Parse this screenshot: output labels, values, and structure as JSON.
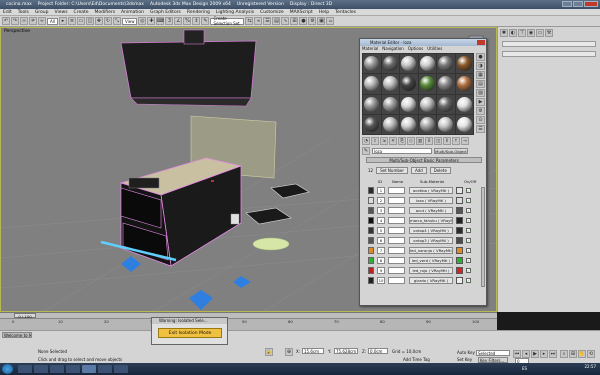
{
  "titlebar": {
    "app_file": "cocina.max",
    "project": "Project Folder: C:\\Users\\Ed\\Documents\\3dsmax",
    "app": "Autodesk 3ds Max Design 2009 x64",
    "status": "Unregistered Version",
    "display": "Display : Direct 3D"
  },
  "menubar": [
    "Edit",
    "Tools",
    "Group",
    "Views",
    "Create",
    "Modifiers",
    "Animation",
    "Graph Editors",
    "Rendering",
    "Lighting Analysis",
    "Customize",
    "MAXScript",
    "Help",
    "Tentacles"
  ],
  "toolbar": {
    "selection_filter": "All",
    "ref_coord": "View",
    "named_selection": "Create Selection Set"
  },
  "viewport": {
    "label": "Perspective"
  },
  "material_editor": {
    "title": "Material Editor - loza",
    "menu": [
      "Material",
      "Navigation",
      "Options",
      "Utilities"
    ],
    "material_name": "loza",
    "material_type": "Multi/Sub-Object",
    "rollout_title": "Multi/Sub-Object Basic Parameters",
    "count": "12",
    "set_number_label": "Set Number",
    "add_label": "Add",
    "delete_label": "Delete",
    "col_id": "ID",
    "col_name": "Name",
    "col_sub": "Sub-Material",
    "col_onoff": "On/Off",
    "sub_materials": [
      {
        "id": "1",
        "name": "",
        "sub": "acetiba ( VRayMtl )",
        "swatch": "#2a2a2a",
        "color": "#e6e6e6"
      },
      {
        "id": "2",
        "name": "",
        "sub": "loza ( VRayMtl )",
        "swatch": "#dcdcdc",
        "color": "#dcdcdc"
      },
      {
        "id": "3",
        "name": "",
        "sub": "acut ( VRayMtl )",
        "swatch": "#555555",
        "color": "#555555"
      },
      {
        "id": "4",
        "name": "",
        "sub": "marco_fahuku ( VRayMtl )",
        "swatch": "#111111",
        "color": "#222222"
      },
      {
        "id": "5",
        "name": "",
        "sub": "ontop4 ( VRayMtl )",
        "swatch": "#333333",
        "color": "#2a2a2a"
      },
      {
        "id": "6",
        "name": "",
        "sub": "ontop3 ( VRayMtl )",
        "swatch": "#555555",
        "color": "#4a4a4a"
      },
      {
        "id": "7",
        "name": "",
        "sub": "led_naranjo ( VRayMtl )",
        "swatch": "#e08a20",
        "color": "#e08a20"
      },
      {
        "id": "8",
        "name": "",
        "sub": "led_verd ( VRayMtl )",
        "swatch": "#2fae3a",
        "color": "#2fae3a"
      },
      {
        "id": "9",
        "name": "",
        "sub": "led_rojo ( VRayMtl )",
        "swatch": "#c41e1e",
        "color": "#d22626"
      },
      {
        "id": "10",
        "name": "",
        "sub": "giardo ( VRayMtl )",
        "swatch": "#222222",
        "color": "#eeeeee"
      }
    ]
  },
  "timeline": {
    "frame": "0 / 100",
    "ticks": [
      "0",
      "10",
      "20",
      "30",
      "40",
      "50",
      "60",
      "70",
      "80",
      "90",
      "100"
    ]
  },
  "status": {
    "selection": "None Selected",
    "prompt": "Click and drag to select and move objects",
    "x_label": "X:",
    "x_value": "15,6cm",
    "y_label": "Y:",
    "y_value": "75,628cm",
    "z_label": "Z:",
    "z_value": "0,0cm",
    "grid": "Grid = 10,0cm",
    "add_time_tag": "Add Time Tag",
    "auto_key": "Auto Key",
    "set_key": "Set Key",
    "selected": "Selected",
    "key_filters": "Key Filters...",
    "current_frame": "0",
    "maxscript_label": "Welcome to M"
  },
  "warning": {
    "title": "Warning: Isolated Sele...",
    "button": "Exit Isolation Mode"
  },
  "taskbar": {
    "lang": "ES",
    "time": "22:57"
  }
}
